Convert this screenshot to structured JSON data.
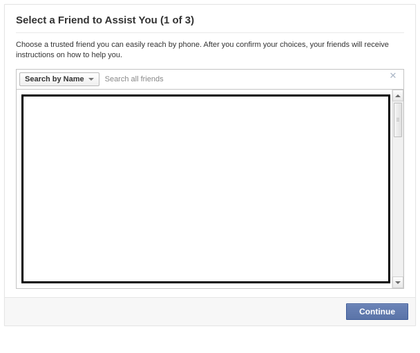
{
  "header": {
    "title": "Select a Friend to Assist You (1 of 3)"
  },
  "instructions": "Choose a trusted friend you can easily reach by phone. After you confirm your choices, your friends will receive instructions on how to help you.",
  "search": {
    "dropdown_label": "Search by Name",
    "placeholder": "Search all friends",
    "value": ""
  },
  "footer": {
    "continue_label": "Continue"
  }
}
